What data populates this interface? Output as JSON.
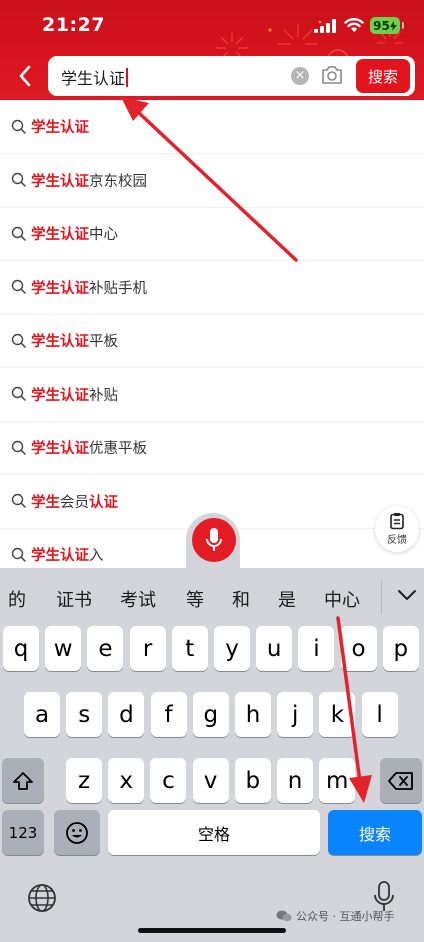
{
  "status_bar": {
    "time": "21:27",
    "battery": "95"
  },
  "search": {
    "query": "学生认证",
    "button_label": "搜索"
  },
  "suggestions": [
    {
      "highlight": "学生认证",
      "rest": "",
      "highlight2": ""
    },
    {
      "highlight": "学生认证",
      "rest": "京东校园",
      "highlight2": ""
    },
    {
      "highlight": "学生认证",
      "rest": "中心",
      "highlight2": ""
    },
    {
      "highlight": "学生认证",
      "rest": "补贴手机",
      "highlight2": ""
    },
    {
      "highlight": "学生认证",
      "rest": "平板",
      "highlight2": ""
    },
    {
      "highlight": "学生认证",
      "rest": "补贴",
      "highlight2": ""
    },
    {
      "highlight": "学生认证",
      "rest": "优惠平板",
      "highlight2": ""
    },
    {
      "highlight": "学生",
      "rest": "会员",
      "highlight2": "认证"
    },
    {
      "highlight": "学生认证",
      "rest": "入",
      "highlight2": ""
    }
  ],
  "feedback": {
    "label": "反馈"
  },
  "keyboard": {
    "candidates": [
      "的",
      "证书",
      "考试",
      "等",
      "和",
      "是",
      "中心"
    ],
    "row1": [
      "q",
      "w",
      "e",
      "r",
      "t",
      "y",
      "u",
      "i",
      "o",
      "p"
    ],
    "row2": [
      "a",
      "s",
      "d",
      "f",
      "g",
      "h",
      "j",
      "k",
      "l"
    ],
    "row3": [
      "z",
      "x",
      "c",
      "v",
      "b",
      "n",
      "m"
    ],
    "numbers_label": "123",
    "space_label": "空格",
    "go_label": "搜索"
  },
  "watermark": {
    "text": "公众号 · 互通小帮手"
  },
  "colors": {
    "brand_red": "#e1131c",
    "keyboard_bg": "#d3d5db",
    "go_key_blue": "#0a84ff",
    "annotation_arrow": "#e3222b"
  },
  "icons": {
    "back": "chevron-left-icon",
    "clear": "clear-icon",
    "camera": "camera-icon",
    "suggestion": "search-icon",
    "feedback": "clipboard-icon",
    "voice": "microphone-icon",
    "collapse": "chevron-down-icon",
    "shift": "shift-icon",
    "delete": "backspace-icon",
    "emoji": "emoji-icon",
    "globe": "globe-icon",
    "dictation": "microphone-icon"
  }
}
